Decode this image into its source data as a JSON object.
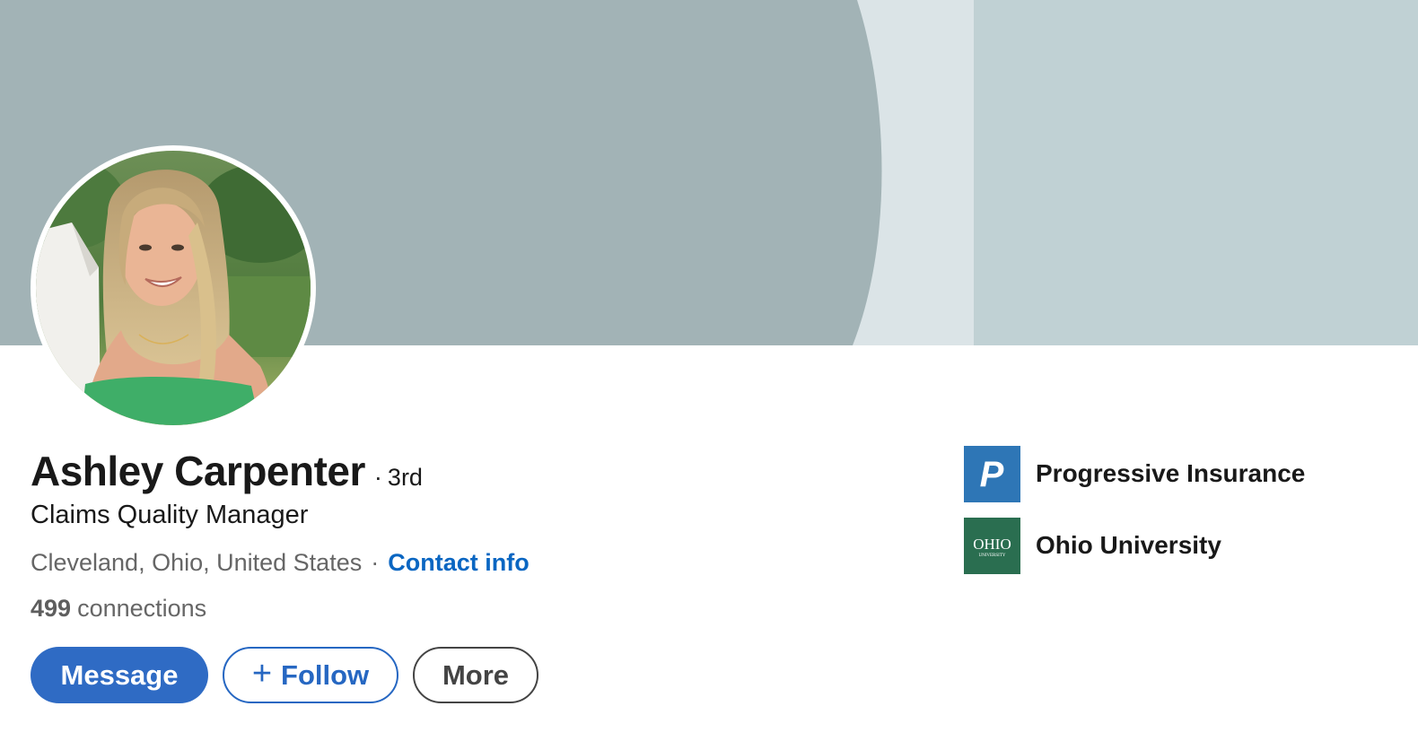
{
  "profile": {
    "name": "Ashley Carpenter",
    "degree_separator": "·",
    "degree": "3rd",
    "headline": "Claims Quality Manager",
    "location": "Cleveland, Ohio, United States",
    "location_separator": "·",
    "contact_info_label": "Contact info",
    "connections_count": "499",
    "connections_label": "connections"
  },
  "actions": {
    "message_label": "Message",
    "follow_plus": "+",
    "follow_label": "Follow",
    "more_label": "More"
  },
  "side": {
    "company": {
      "name": "Progressive Insurance",
      "logo_letter": "P",
      "logo_color": "#2e76b6"
    },
    "education": {
      "name": "Ohio University",
      "logo_text": "OHIO",
      "logo_subtext": "UNIVERSITY",
      "logo_color": "#2a6e50"
    }
  },
  "colors": {
    "banner_left": "#a2b3b6",
    "banner_mid": "#dbe4e7",
    "banner_right": "#c0d1d4",
    "brand_blue": "#2f6bc4",
    "muted_text": "#666666"
  },
  "icons": {
    "avatar": "profile-photo",
    "company_logo": "progressive-logo",
    "education_logo": "ohio-university-logo"
  }
}
